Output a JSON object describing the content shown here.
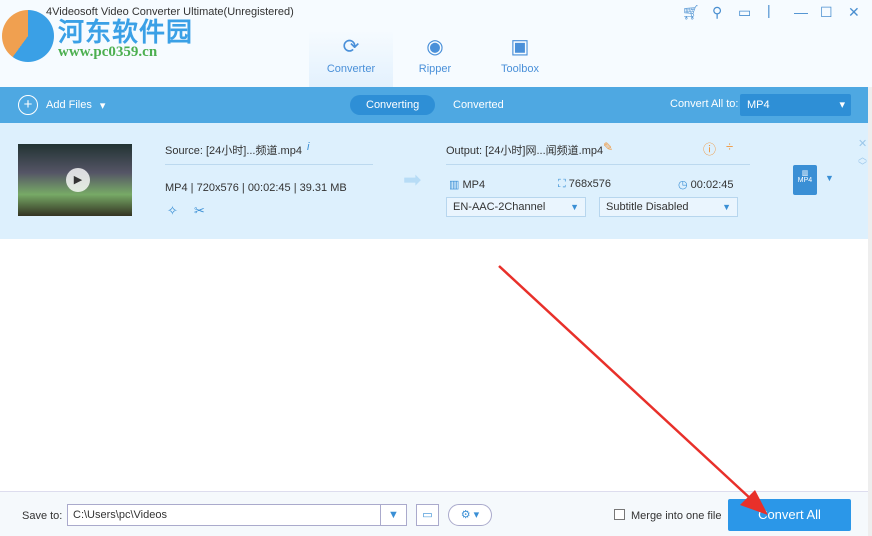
{
  "window": {
    "title": "4Videosoft Video Converter Ultimate(Unregistered)",
    "controls": [
      "cart-icon",
      "key-icon",
      "feedback-icon",
      "minimize-icon",
      "maximize-icon",
      "close-icon"
    ]
  },
  "watermark": {
    "name": "河东软件园",
    "url": "www.pc0359.cn"
  },
  "main_tabs": [
    {
      "label": "Converter",
      "icon": "converter-icon",
      "active": true
    },
    {
      "label": "Ripper",
      "icon": "ripper-icon"
    },
    {
      "label": "Toolbox",
      "icon": "toolbox-icon"
    }
  ],
  "toolbar": {
    "add_files": "Add Files",
    "tabs": [
      "Converting",
      "Converted"
    ],
    "convert_all_to_label": "Convert All to:",
    "convert_all_to_value": "MP4"
  },
  "item": {
    "source": "Source: [24小时]...频道.mp4",
    "format": "MP4",
    "resolution": "720x576",
    "duration": "00:02:45",
    "size": "39.31 MB",
    "output": "Output: [24小时]网...闻频道.mp4",
    "out_format": "MP4",
    "out_resolution": "768x576",
    "out_duration": "00:02:45",
    "audio": "EN-AAC-2Channel",
    "subtitle": "Subtitle Disabled",
    "format_badge": "MP4"
  },
  "footer": {
    "save_to_label": "Save to:",
    "save_path": "C:\\Users\\pc\\Videos",
    "merge_label": "Merge into one file",
    "merge_checked": false,
    "convert_all": "Convert All"
  },
  "colors": {
    "accent": "#4ea8e2",
    "button": "#2b97e8",
    "annotation_arrow": "#e8302a"
  }
}
